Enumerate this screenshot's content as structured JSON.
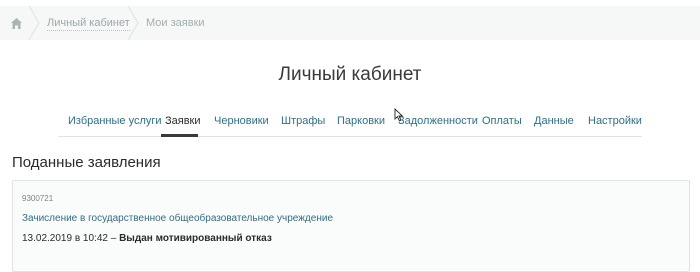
{
  "breadcrumb": {
    "items": [
      {
        "label": "Личный кабинет"
      },
      {
        "label": "Мои заявки"
      }
    ]
  },
  "page": {
    "title": "Личный кабинет"
  },
  "tabs": [
    {
      "label": "Избранные услуги"
    },
    {
      "label": "Заявки",
      "active": true
    },
    {
      "label": "Черновики"
    },
    {
      "label": "Штрафы"
    },
    {
      "label": "Парковки"
    },
    {
      "label": "Задолженности"
    },
    {
      "label": "Оплаты"
    },
    {
      "label": "Данные"
    },
    {
      "label": "Настройки"
    }
  ],
  "section": {
    "title": "Поданные заявления"
  },
  "applications": [
    {
      "number": "9300721",
      "service": "Зачисление в государственное общеобразовательное учреждение",
      "date": "13.02.2019 в 10:42",
      "separator": "–",
      "status": "Выдан мотивированный отказ"
    }
  ],
  "icons": {
    "home": "home-icon",
    "separator": "chevron-right-icon",
    "cursor": "mouse-pointer-icon"
  },
  "colors": {
    "link": "#2f6f86",
    "breadcrumb_bg": "#f6f8f8",
    "active_tab_underline": "#3a3a3a"
  }
}
